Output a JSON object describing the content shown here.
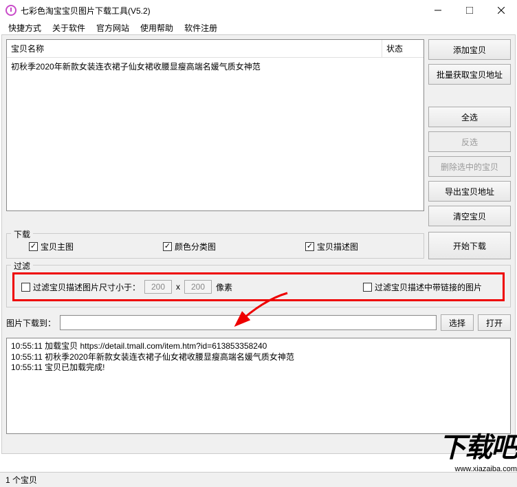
{
  "window": {
    "title": "七彩色淘宝宝贝图片下载工具(V5.2)"
  },
  "menu": {
    "quick": "快捷方式",
    "about": "关于软件",
    "site": "官方网站",
    "help": "使用帮助",
    "register": "软件注册"
  },
  "list": {
    "col_name": "宝贝名称",
    "col_status": "状态",
    "row1": "初秋季2020年新款女装连衣裙子仙女裙收腰显瘦高端名媛气质女神范"
  },
  "buttons": {
    "add": "添加宝贝",
    "batch": "批量获取宝贝地址",
    "select_all": "全选",
    "invert": "反选",
    "delete_sel": "删除选中的宝贝",
    "export": "导出宝贝地址",
    "clear": "清空宝贝",
    "start": "开始下载",
    "choose": "选择",
    "open": "打开"
  },
  "download": {
    "title": "下载",
    "main_img": "宝贝主图",
    "color_img": "颜色分类图",
    "desc_img": "宝贝描述图"
  },
  "filter": {
    "title": "过滤",
    "size_label1": "过滤宝贝描述图片尺寸小于：",
    "w": "200",
    "x": "x",
    "h": "200",
    "px": "像素",
    "link_img": "过滤宝贝描述中带链接的图片"
  },
  "path": {
    "label": "图片下载到：",
    "value": ""
  },
  "log": {
    "l1": "10:55:11 加载宝贝 https://detail.tmall.com/item.htm?id=613853358240",
    "l2": "10:55:11 初秋季2020年新款女装连衣裙子仙女裙收腰显瘦高端名媛气质女神范",
    "l3": "10:55:11 宝贝已加载完成!"
  },
  "status": {
    "count": "1 个宝贝"
  },
  "watermark": {
    "big": "下载吧",
    "small": "www.xiazaiba.com"
  }
}
